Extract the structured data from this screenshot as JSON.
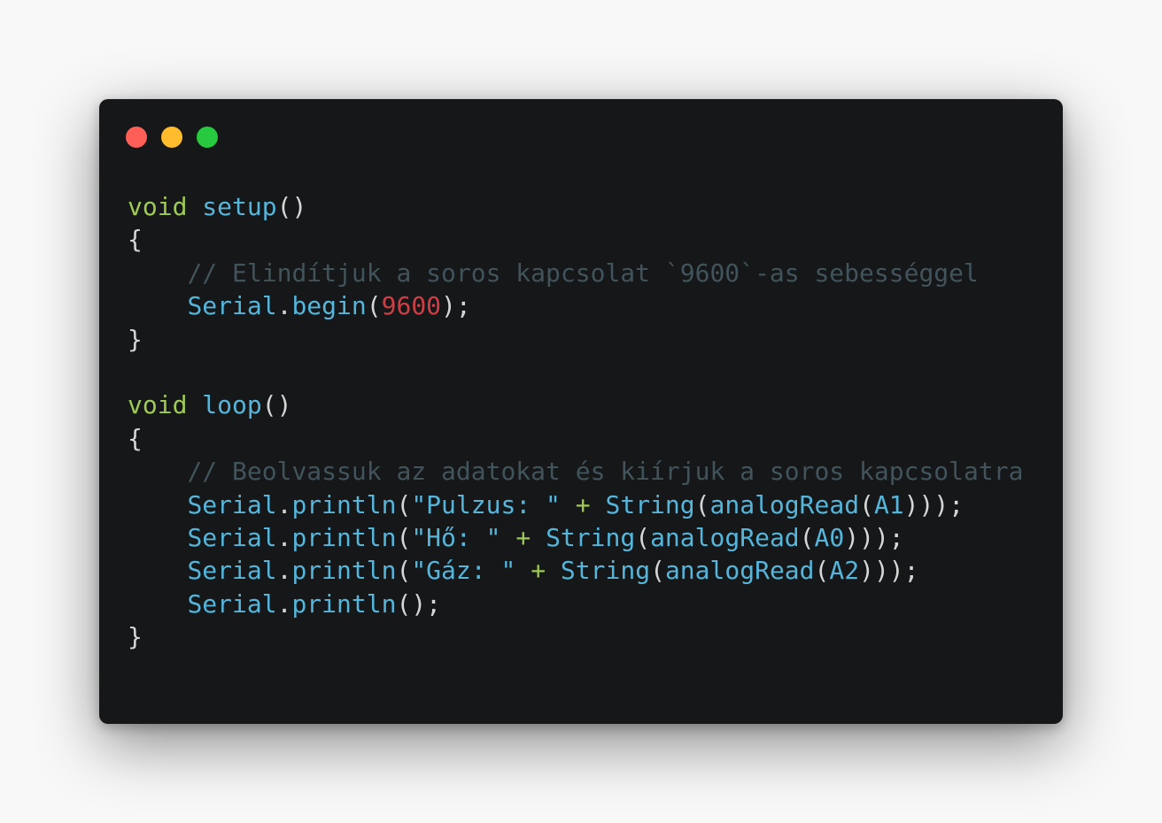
{
  "window": {
    "controls": {
      "close_color": "#ff5f56",
      "minimize_color": "#ffbd2e",
      "maximize_color": "#27c93f"
    }
  },
  "colors": {
    "background": "#151718",
    "keyword": "#9fca56",
    "function": "#55b5db",
    "number": "#cd3f45",
    "comment": "#41535b",
    "text": "#d4d7d6"
  },
  "code": {
    "lines": [
      [
        {
          "t": "void",
          "c": "kw"
        },
        {
          "t": " ",
          "c": "plain"
        },
        {
          "t": "setup",
          "c": "fn"
        },
        {
          "t": "()",
          "c": "plain"
        }
      ],
      [
        {
          "t": "{",
          "c": "plain"
        }
      ],
      [
        {
          "t": "    ",
          "c": "plain"
        },
        {
          "t": "// Elindítjuk a soros kapcsolat `9600`-as sebességgel",
          "c": "cmt"
        }
      ],
      [
        {
          "t": "    ",
          "c": "plain"
        },
        {
          "t": "Serial",
          "c": "fn"
        },
        {
          "t": ".",
          "c": "plain"
        },
        {
          "t": "begin",
          "c": "fn"
        },
        {
          "t": "(",
          "c": "plain"
        },
        {
          "t": "9600",
          "c": "num"
        },
        {
          "t": ");",
          "c": "plain"
        }
      ],
      [
        {
          "t": "}",
          "c": "plain"
        }
      ],
      [],
      [
        {
          "t": "void",
          "c": "kw"
        },
        {
          "t": " ",
          "c": "plain"
        },
        {
          "t": "loop",
          "c": "fn"
        },
        {
          "t": "()",
          "c": "plain"
        }
      ],
      [
        {
          "t": "{",
          "c": "plain"
        }
      ],
      [
        {
          "t": "    ",
          "c": "plain"
        },
        {
          "t": "// Beolvassuk az adatokat és kiírjuk a soros kapcsolatra",
          "c": "cmt"
        }
      ],
      [
        {
          "t": "    ",
          "c": "plain"
        },
        {
          "t": "Serial",
          "c": "fn"
        },
        {
          "t": ".",
          "c": "plain"
        },
        {
          "t": "println",
          "c": "fn"
        },
        {
          "t": "(",
          "c": "plain"
        },
        {
          "t": "\"Pulzus: \"",
          "c": "str"
        },
        {
          "t": " ",
          "c": "plain"
        },
        {
          "t": "+",
          "c": "op"
        },
        {
          "t": " ",
          "c": "plain"
        },
        {
          "t": "String",
          "c": "fn"
        },
        {
          "t": "(",
          "c": "plain"
        },
        {
          "t": "analogRead",
          "c": "fn"
        },
        {
          "t": "(",
          "c": "plain"
        },
        {
          "t": "A1",
          "c": "fn"
        },
        {
          "t": ")));",
          "c": "plain"
        }
      ],
      [
        {
          "t": "    ",
          "c": "plain"
        },
        {
          "t": "Serial",
          "c": "fn"
        },
        {
          "t": ".",
          "c": "plain"
        },
        {
          "t": "println",
          "c": "fn"
        },
        {
          "t": "(",
          "c": "plain"
        },
        {
          "t": "\"Hő: \"",
          "c": "str"
        },
        {
          "t": " ",
          "c": "plain"
        },
        {
          "t": "+",
          "c": "op"
        },
        {
          "t": " ",
          "c": "plain"
        },
        {
          "t": "String",
          "c": "fn"
        },
        {
          "t": "(",
          "c": "plain"
        },
        {
          "t": "analogRead",
          "c": "fn"
        },
        {
          "t": "(",
          "c": "plain"
        },
        {
          "t": "A0",
          "c": "fn"
        },
        {
          "t": ")));",
          "c": "plain"
        }
      ],
      [
        {
          "t": "    ",
          "c": "plain"
        },
        {
          "t": "Serial",
          "c": "fn"
        },
        {
          "t": ".",
          "c": "plain"
        },
        {
          "t": "println",
          "c": "fn"
        },
        {
          "t": "(",
          "c": "plain"
        },
        {
          "t": "\"Gáz: \"",
          "c": "str"
        },
        {
          "t": " ",
          "c": "plain"
        },
        {
          "t": "+",
          "c": "op"
        },
        {
          "t": " ",
          "c": "plain"
        },
        {
          "t": "String",
          "c": "fn"
        },
        {
          "t": "(",
          "c": "plain"
        },
        {
          "t": "analogRead",
          "c": "fn"
        },
        {
          "t": "(",
          "c": "plain"
        },
        {
          "t": "A2",
          "c": "fn"
        },
        {
          "t": ")));",
          "c": "plain"
        }
      ],
      [
        {
          "t": "    ",
          "c": "plain"
        },
        {
          "t": "Serial",
          "c": "fn"
        },
        {
          "t": ".",
          "c": "plain"
        },
        {
          "t": "println",
          "c": "fn"
        },
        {
          "t": "();",
          "c": "plain"
        }
      ],
      [
        {
          "t": "}",
          "c": "plain"
        }
      ]
    ]
  }
}
